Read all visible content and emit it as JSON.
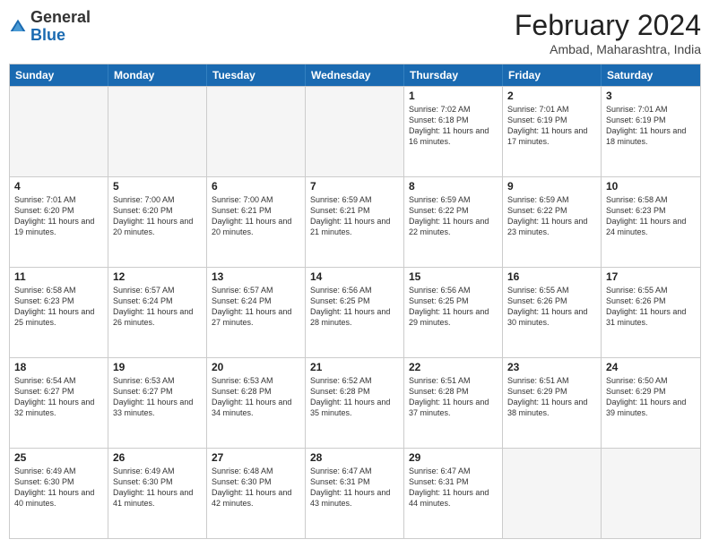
{
  "header": {
    "logo_line1": "General",
    "logo_line2": "Blue",
    "month_title": "February 2024",
    "subtitle": "Ambad, Maharashtra, India"
  },
  "weekdays": [
    "Sunday",
    "Monday",
    "Tuesday",
    "Wednesday",
    "Thursday",
    "Friday",
    "Saturday"
  ],
  "rows": [
    [
      {
        "day": "",
        "sunrise": "",
        "sunset": "",
        "daylight": "",
        "empty": true
      },
      {
        "day": "",
        "sunrise": "",
        "sunset": "",
        "daylight": "",
        "empty": true
      },
      {
        "day": "",
        "sunrise": "",
        "sunset": "",
        "daylight": "",
        "empty": true
      },
      {
        "day": "",
        "sunrise": "",
        "sunset": "",
        "daylight": "",
        "empty": true
      },
      {
        "day": "1",
        "sunrise": "Sunrise: 7:02 AM",
        "sunset": "Sunset: 6:18 PM",
        "daylight": "Daylight: 11 hours and 16 minutes."
      },
      {
        "day": "2",
        "sunrise": "Sunrise: 7:01 AM",
        "sunset": "Sunset: 6:19 PM",
        "daylight": "Daylight: 11 hours and 17 minutes."
      },
      {
        "day": "3",
        "sunrise": "Sunrise: 7:01 AM",
        "sunset": "Sunset: 6:19 PM",
        "daylight": "Daylight: 11 hours and 18 minutes."
      }
    ],
    [
      {
        "day": "4",
        "sunrise": "Sunrise: 7:01 AM",
        "sunset": "Sunset: 6:20 PM",
        "daylight": "Daylight: 11 hours and 19 minutes."
      },
      {
        "day": "5",
        "sunrise": "Sunrise: 7:00 AM",
        "sunset": "Sunset: 6:20 PM",
        "daylight": "Daylight: 11 hours and 20 minutes."
      },
      {
        "day": "6",
        "sunrise": "Sunrise: 7:00 AM",
        "sunset": "Sunset: 6:21 PM",
        "daylight": "Daylight: 11 hours and 20 minutes."
      },
      {
        "day": "7",
        "sunrise": "Sunrise: 6:59 AM",
        "sunset": "Sunset: 6:21 PM",
        "daylight": "Daylight: 11 hours and 21 minutes."
      },
      {
        "day": "8",
        "sunrise": "Sunrise: 6:59 AM",
        "sunset": "Sunset: 6:22 PM",
        "daylight": "Daylight: 11 hours and 22 minutes."
      },
      {
        "day": "9",
        "sunrise": "Sunrise: 6:59 AM",
        "sunset": "Sunset: 6:22 PM",
        "daylight": "Daylight: 11 hours and 23 minutes."
      },
      {
        "day": "10",
        "sunrise": "Sunrise: 6:58 AM",
        "sunset": "Sunset: 6:23 PM",
        "daylight": "Daylight: 11 hours and 24 minutes."
      }
    ],
    [
      {
        "day": "11",
        "sunrise": "Sunrise: 6:58 AM",
        "sunset": "Sunset: 6:23 PM",
        "daylight": "Daylight: 11 hours and 25 minutes."
      },
      {
        "day": "12",
        "sunrise": "Sunrise: 6:57 AM",
        "sunset": "Sunset: 6:24 PM",
        "daylight": "Daylight: 11 hours and 26 minutes."
      },
      {
        "day": "13",
        "sunrise": "Sunrise: 6:57 AM",
        "sunset": "Sunset: 6:24 PM",
        "daylight": "Daylight: 11 hours and 27 minutes."
      },
      {
        "day": "14",
        "sunrise": "Sunrise: 6:56 AM",
        "sunset": "Sunset: 6:25 PM",
        "daylight": "Daylight: 11 hours and 28 minutes."
      },
      {
        "day": "15",
        "sunrise": "Sunrise: 6:56 AM",
        "sunset": "Sunset: 6:25 PM",
        "daylight": "Daylight: 11 hours and 29 minutes."
      },
      {
        "day": "16",
        "sunrise": "Sunrise: 6:55 AM",
        "sunset": "Sunset: 6:26 PM",
        "daylight": "Daylight: 11 hours and 30 minutes."
      },
      {
        "day": "17",
        "sunrise": "Sunrise: 6:55 AM",
        "sunset": "Sunset: 6:26 PM",
        "daylight": "Daylight: 11 hours and 31 minutes."
      }
    ],
    [
      {
        "day": "18",
        "sunrise": "Sunrise: 6:54 AM",
        "sunset": "Sunset: 6:27 PM",
        "daylight": "Daylight: 11 hours and 32 minutes."
      },
      {
        "day": "19",
        "sunrise": "Sunrise: 6:53 AM",
        "sunset": "Sunset: 6:27 PM",
        "daylight": "Daylight: 11 hours and 33 minutes."
      },
      {
        "day": "20",
        "sunrise": "Sunrise: 6:53 AM",
        "sunset": "Sunset: 6:28 PM",
        "daylight": "Daylight: 11 hours and 34 minutes."
      },
      {
        "day": "21",
        "sunrise": "Sunrise: 6:52 AM",
        "sunset": "Sunset: 6:28 PM",
        "daylight": "Daylight: 11 hours and 35 minutes."
      },
      {
        "day": "22",
        "sunrise": "Sunrise: 6:51 AM",
        "sunset": "Sunset: 6:28 PM",
        "daylight": "Daylight: 11 hours and 37 minutes."
      },
      {
        "day": "23",
        "sunrise": "Sunrise: 6:51 AM",
        "sunset": "Sunset: 6:29 PM",
        "daylight": "Daylight: 11 hours and 38 minutes."
      },
      {
        "day": "24",
        "sunrise": "Sunrise: 6:50 AM",
        "sunset": "Sunset: 6:29 PM",
        "daylight": "Daylight: 11 hours and 39 minutes."
      }
    ],
    [
      {
        "day": "25",
        "sunrise": "Sunrise: 6:49 AM",
        "sunset": "Sunset: 6:30 PM",
        "daylight": "Daylight: 11 hours and 40 minutes."
      },
      {
        "day": "26",
        "sunrise": "Sunrise: 6:49 AM",
        "sunset": "Sunset: 6:30 PM",
        "daylight": "Daylight: 11 hours and 41 minutes."
      },
      {
        "day": "27",
        "sunrise": "Sunrise: 6:48 AM",
        "sunset": "Sunset: 6:30 PM",
        "daylight": "Daylight: 11 hours and 42 minutes."
      },
      {
        "day": "28",
        "sunrise": "Sunrise: 6:47 AM",
        "sunset": "Sunset: 6:31 PM",
        "daylight": "Daylight: 11 hours and 43 minutes."
      },
      {
        "day": "29",
        "sunrise": "Sunrise: 6:47 AM",
        "sunset": "Sunset: 6:31 PM",
        "daylight": "Daylight: 11 hours and 44 minutes."
      },
      {
        "day": "",
        "sunrise": "",
        "sunset": "",
        "daylight": "",
        "empty": true
      },
      {
        "day": "",
        "sunrise": "",
        "sunset": "",
        "daylight": "",
        "empty": true
      }
    ]
  ]
}
